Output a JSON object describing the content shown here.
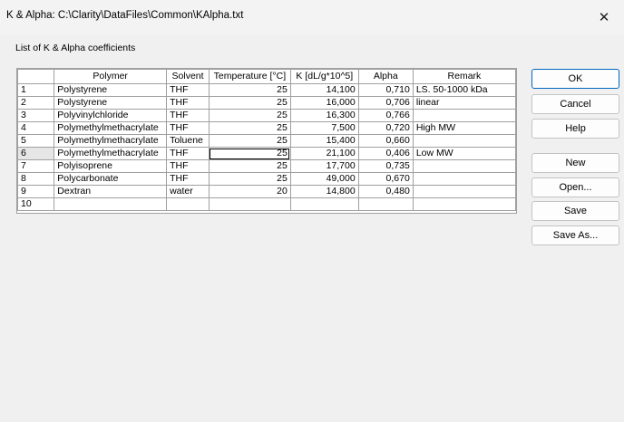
{
  "window": {
    "title": "K & Alpha: C:\\Clarity\\DataFiles\\Common\\KAlpha.txt"
  },
  "list_label": "List of K & Alpha coefficients",
  "table": {
    "headers": [
      "",
      "Polymer",
      "Solvent",
      "Temperature [°C]",
      "K [dL/g*10^5]",
      "Alpha",
      "Remark"
    ],
    "rows": [
      [
        "1",
        "Polystyrene",
        "THF",
        "25",
        "14,100",
        "0,710",
        "LS. 50-1000 kDa"
      ],
      [
        "2",
        "Polystyrene",
        "THF",
        "25",
        "16,000",
        "0,706",
        "linear"
      ],
      [
        "3",
        "Polyvinylchloride",
        "THF",
        "25",
        "16,300",
        "0,766",
        ""
      ],
      [
        "4",
        "Polymethylmethacrylate",
        "THF",
        "25",
        "7,500",
        "0,720",
        "High MW"
      ],
      [
        "5",
        "Polymethylmethacrylate",
        "Toluene",
        "25",
        "15,400",
        "0,660",
        ""
      ],
      [
        "6",
        "Polymethylmethacrylate",
        "THF",
        "25",
        "21,100",
        "0,406",
        "Low MW"
      ],
      [
        "7",
        "Polyisoprene",
        "THF",
        "25",
        "17,700",
        "0,735",
        ""
      ],
      [
        "8",
        "Polycarbonate",
        "THF",
        "25",
        "49,000",
        "0,670",
        ""
      ],
      [
        "9",
        "Dextran",
        "water",
        "20",
        "14,800",
        "0,480",
        ""
      ],
      [
        "10",
        "",
        "",
        "",
        "",
        "",
        ""
      ]
    ]
  },
  "buttons": {
    "ok": "OK",
    "cancel": "Cancel",
    "help": "Help",
    "new": "New",
    "open": "Open...",
    "save": "Save",
    "save_as": "Save As..."
  }
}
